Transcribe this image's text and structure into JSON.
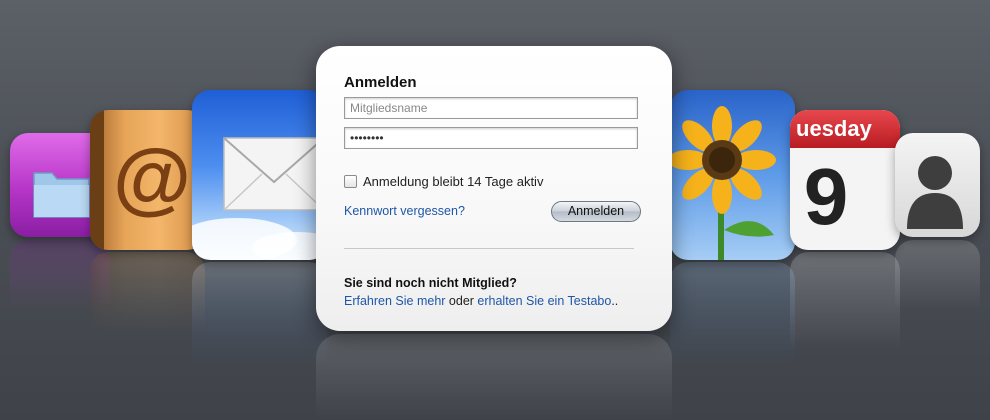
{
  "login": {
    "title": "Anmelden",
    "username_placeholder": "Mitgliedsname",
    "password_value": "••••••••",
    "remember_label": "Anmeldung bleibt 14 Tage aktiv",
    "remember_checked": false,
    "forgot_link": "Kennwort vergessen?",
    "submit_label": "Anmelden"
  },
  "signup": {
    "question": "Sie sind noch nicht Mitglied?",
    "learn_more_link": "Erfahren Sie mehr",
    "connector": " oder ",
    "trial_link": "erhalten Sie ein Testabo",
    "trailing": ".."
  },
  "apps": [
    {
      "name": "files",
      "icon": "folder-icon"
    },
    {
      "name": "contacts-book",
      "icon": "at-sign-icon"
    },
    {
      "name": "mail",
      "icon": "envelope-icon"
    },
    {
      "name": "photos",
      "icon": "sunflower-icon"
    },
    {
      "name": "calendar",
      "icon": "calendar-icon",
      "weekday": "uesday",
      "day": "9"
    },
    {
      "name": "contacts",
      "icon": "person-silhouette-icon"
    }
  ],
  "colors": {
    "link": "#1f56a8",
    "calendar_header": "#d7262c"
  }
}
